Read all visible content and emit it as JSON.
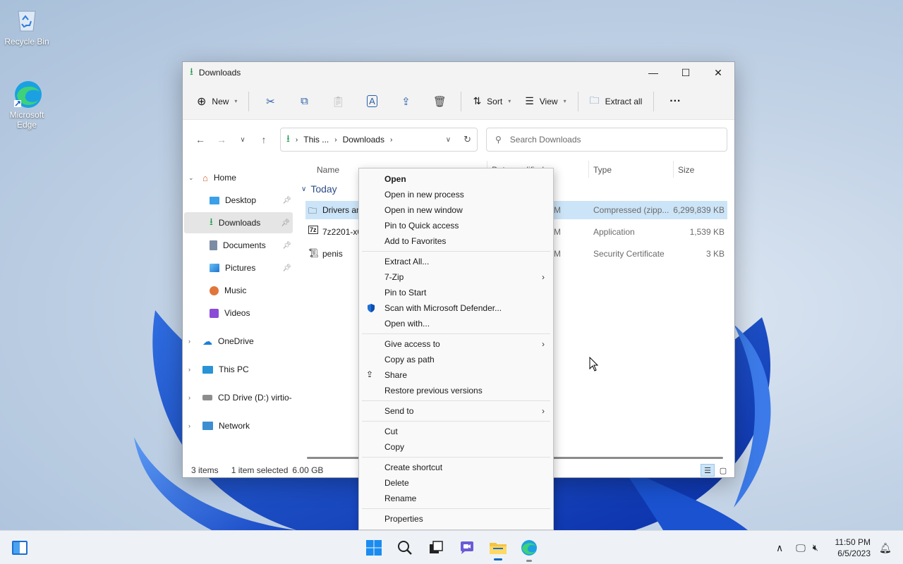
{
  "desktop": {
    "icons": [
      {
        "label": "Recycle Bin",
        "icon": "recycle-bin-icon"
      },
      {
        "label": "Microsoft Edge",
        "icon": "edge-icon"
      }
    ]
  },
  "window": {
    "title": "Downloads",
    "toolbar": {
      "new_label": "New",
      "sort_label": "Sort",
      "view_label": "View",
      "extract_all_label": "Extract all",
      "more_label": "···"
    },
    "address": {
      "crumb_1": "This ...",
      "crumb_2": "Downloads"
    },
    "search": {
      "placeholder": "Search Downloads"
    },
    "nav": {
      "home": "Home",
      "desktop": "Desktop",
      "downloads": "Downloads",
      "documents": "Documents",
      "pictures": "Pictures",
      "music": "Music",
      "videos": "Videos",
      "onedrive": "OneDrive",
      "thispc": "This PC",
      "cddrive": "CD Drive (D:) virtio-",
      "network": "Network"
    },
    "columns": {
      "name": "Name",
      "date": "Date modified",
      "type": "Type",
      "size": "Size"
    },
    "group": "Today",
    "files": [
      {
        "name": "Drivers an",
        "date_tail": "M",
        "type": "Compressed (zipp...",
        "size": "6,299,839 KB",
        "selected": true
      },
      {
        "name": "7z2201-x6",
        "date_tail": "M",
        "type": "Application",
        "size": "1,539 KB",
        "selected": false
      },
      {
        "name": "penis",
        "date_tail": "M",
        "type": "Security Certificate",
        "size": "3 KB",
        "selected": false
      }
    ],
    "status": {
      "items": "3 items",
      "selected": "1 item selected",
      "size": "6.00 GB"
    }
  },
  "context_menu": {
    "open": "Open",
    "open_new_process": "Open in new process",
    "open_new_window": "Open in new window",
    "pin_quick": "Pin to Quick access",
    "add_fav": "Add to Favorites",
    "extract_all": "Extract All...",
    "seven_zip": "7-Zip",
    "pin_start": "Pin to Start",
    "scan": "Scan with Microsoft Defender...",
    "open_with": "Open with...",
    "give_access": "Give access to",
    "copy_path": "Copy as path",
    "share": "Share",
    "restore": "Restore previous versions",
    "send_to": "Send to",
    "cut": "Cut",
    "copy": "Copy",
    "create_shortcut": "Create shortcut",
    "delete": "Delete",
    "rename": "Rename",
    "properties": "Properties"
  },
  "taskbar": {
    "time": "11:50 PM",
    "date": "6/5/2023"
  },
  "colors": {
    "accent": "#0067c0",
    "selection": "#cce4f7"
  }
}
